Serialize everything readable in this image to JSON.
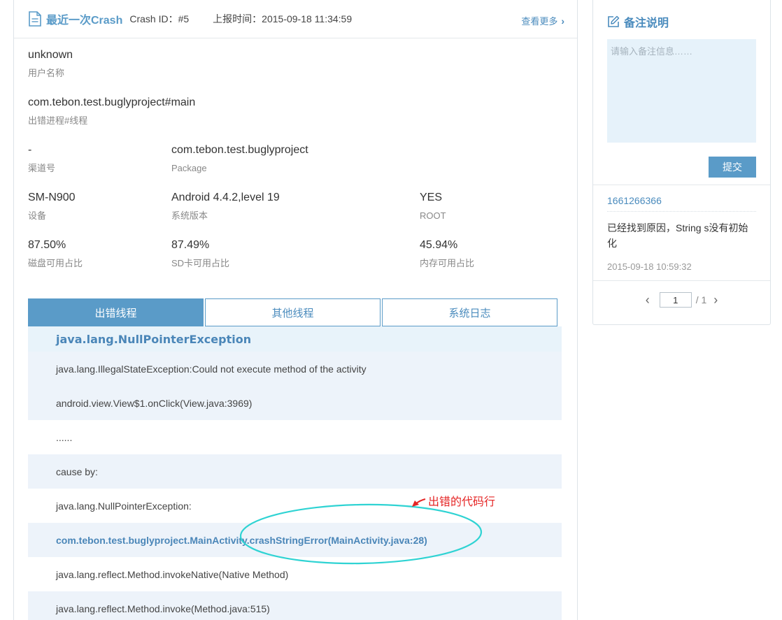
{
  "header": {
    "title": "最近一次Crash",
    "crash_id": "Crash ID：#5",
    "report_time": "上报时间：2015-09-18 11:34:59",
    "view_more": "查看更多"
  },
  "fields": {
    "user": {
      "value": "unknown",
      "label": "用户名称"
    },
    "process": {
      "value": "com.tebon.test.buglyproject#main",
      "label": "出错进程#线程"
    },
    "channel": {
      "value": "-",
      "label": "渠道号"
    },
    "package": {
      "value": "com.tebon.test.buglyproject",
      "label": "Package"
    },
    "device": {
      "value": "SM-N900",
      "label": "设备"
    },
    "os_version": {
      "value": "Android 4.4.2,level 19",
      "label": "系统版本"
    },
    "root": {
      "value": "YES",
      "label": "ROOT"
    },
    "disk": {
      "value": "87.50%",
      "label": "磁盘可用占比"
    },
    "sdcard": {
      "value": "87.49%",
      "label": "SD卡可用占比"
    },
    "memory": {
      "value": "45.94%",
      "label": "内存可用占比"
    }
  },
  "tabs": [
    {
      "label": "出错线程",
      "active": true
    },
    {
      "label": "其他线程",
      "active": false
    },
    {
      "label": "系统日志",
      "active": false
    }
  ],
  "stack": {
    "exception": "java.lang.NullPointerException",
    "lines": [
      "java.lang.IllegalStateException:Could not execute method of the activity",
      "android.view.View$1.onClick(View.java:3969)",
      "......",
      "cause by:",
      "java.lang.NullPointerException:",
      "com.tebon.test.buglyproject.MainActivity.crashStringError(MainActivity.java:28)",
      "java.lang.reflect.Method.invokeNative(Native Method)",
      "java.lang.reflect.Method.invoke(Method.java:515)"
    ]
  },
  "annotation": {
    "text": "出错的代码行",
    "color": "#e52525",
    "ellipse_color": "#2fd3d3"
  },
  "side": {
    "title": "备注说明",
    "placeholder": "请输入备注信息……",
    "submit_label": "提交",
    "comment": {
      "user": "1661266366",
      "text": "已经找到原因，String s没有初始化",
      "time": "2015-09-18 10:59:32"
    },
    "pager": {
      "current": "1",
      "total": "/ 1"
    }
  },
  "colors": {
    "accent": "#5a9bc8",
    "link": "#4a8bbd",
    "row_shade": "#edf3fa"
  }
}
